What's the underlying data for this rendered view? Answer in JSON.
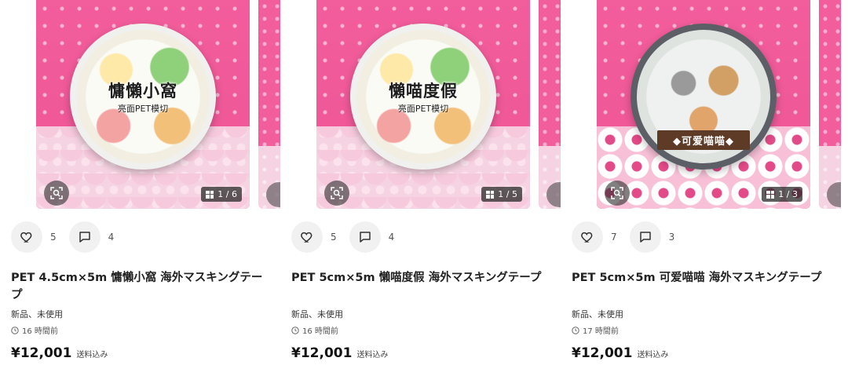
{
  "products": [
    {
      "tape_title": "慵懶小窩",
      "tape_subtitle": "亮面PET模切",
      "image_counter": "1 / 6",
      "likes": "5",
      "comments": "4",
      "title": "PET 4.5cm×5m 慵懶小窩 海外マスキングテープ",
      "condition": "新品、未使用",
      "time_ago": "16 時間前",
      "price": "¥12,001",
      "price_note": "送料込み"
    },
    {
      "tape_title": "懶喵度假",
      "tape_subtitle": "亮面PET模切",
      "image_counter": "1 / 5",
      "likes": "5",
      "comments": "4",
      "title": "PET 5cm×5m 懶喵度假 海外マスキングテープ",
      "condition": "新品、未使用",
      "time_ago": "16 時間前",
      "price": "¥12,001",
      "price_note": "送料込み"
    },
    {
      "tape_title": "◆可爱喵喵◆",
      "tape_subtitle": "",
      "image_counter": "1 / 3",
      "likes": "7",
      "comments": "3",
      "title": "PET 5cm×5m 可爱喵喵 海外マスキングテープ",
      "condition": "新品、未使用",
      "time_ago": "17 時間前",
      "price": "¥12,001",
      "price_note": "送料込み"
    }
  ],
  "icons": {
    "like": "heart-icon",
    "comment": "comment-icon",
    "lens": "image-search-icon",
    "gallery": "gallery-grid-icon",
    "time": "clock-icon"
  },
  "colors": {
    "image_background": "#ef5a9a",
    "button_background": "#f1f1f1"
  }
}
